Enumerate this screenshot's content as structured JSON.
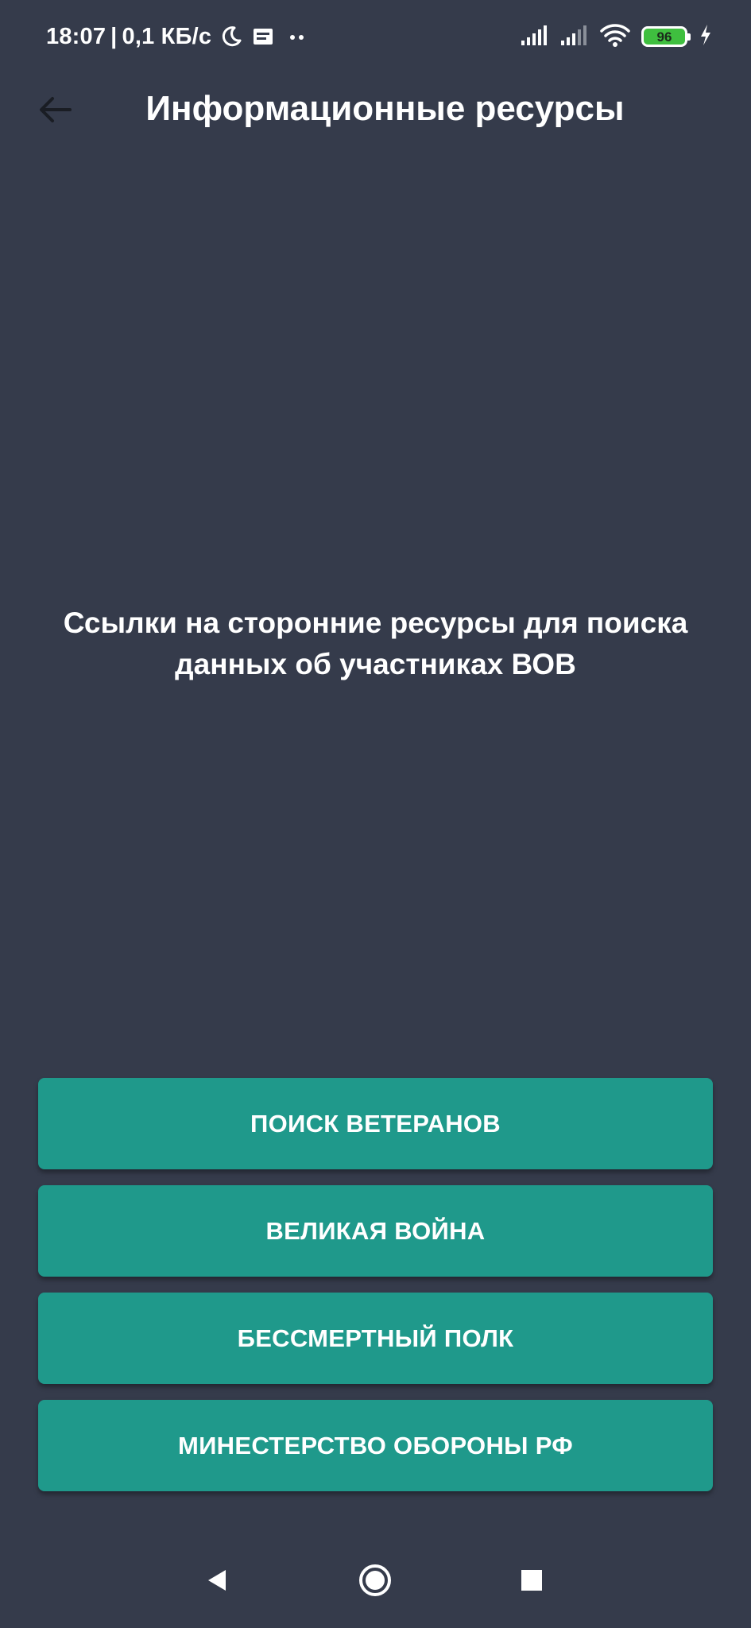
{
  "status_bar": {
    "time": "18:07",
    "separator": "|",
    "network_speed": "0,1 КБ/с",
    "battery_level": "96",
    "icons": [
      "moon-icon",
      "notification-icon",
      "more-dots-icon",
      "signal-icon",
      "signal-icon",
      "wifi-icon",
      "battery-icon",
      "charging-icon"
    ]
  },
  "app_bar": {
    "title": "Информационные ресурсы",
    "back_icon": "arrow-left-icon"
  },
  "description": "Ссылки на сторонние ресурсы для поиска данных об участниках ВОВ",
  "buttons": [
    {
      "label": "ПОИСК ВЕТЕРАНОВ"
    },
    {
      "label": "ВЕЛИКАЯ ВОЙНА"
    },
    {
      "label": "БЕССМЕРТНЫЙ ПОЛК"
    },
    {
      "label": "МИНЕСТЕРСТВО ОБОРОНЫ РФ"
    }
  ],
  "nav_bar": {
    "icons": [
      "back-triangle-icon",
      "home-circle-icon",
      "recents-square-icon"
    ]
  },
  "colors": {
    "background": "#353b4b",
    "button": "#1f998b",
    "text": "#ffffff",
    "battery": "#3fbf3f"
  }
}
